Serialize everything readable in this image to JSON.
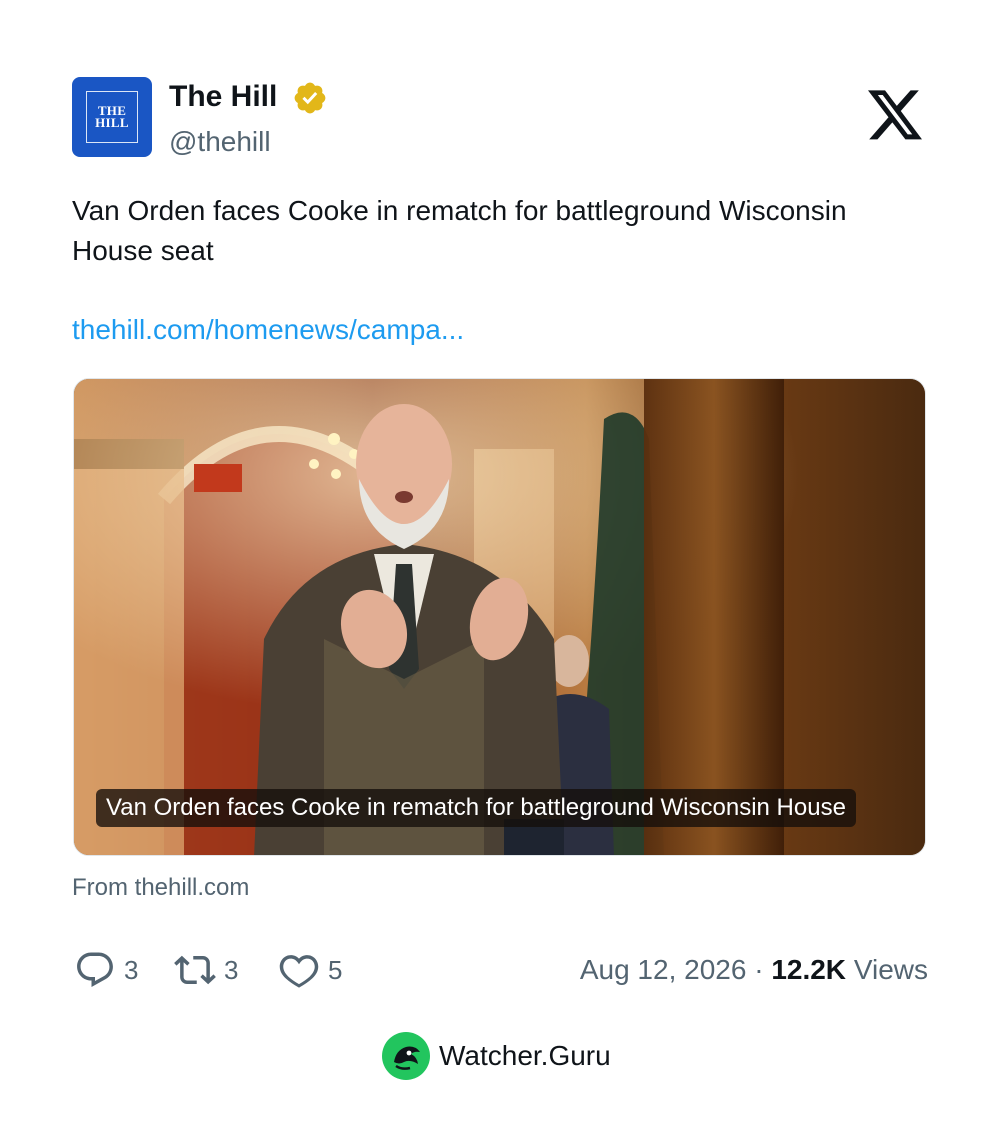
{
  "author": {
    "display_name": "The Hill",
    "handle": "@thehill",
    "avatar_text_line1": "THE",
    "avatar_text_line2": "HILL",
    "avatar_color": "#1a56c4",
    "verified_badge_color": "#e2b719"
  },
  "tweet": {
    "text": "Van Orden faces Cooke in rematch for battleground Wisconsin House seat",
    "link": "thehill.com/homenews/campa..."
  },
  "media": {
    "caption": "Van Orden faces Cooke in rematch for battleground Wisconsin House",
    "source": "From thehill.com"
  },
  "stats": {
    "replies": "3",
    "reposts": "3",
    "likes": "5",
    "date": "Aug 12, 2026",
    "separator": "·",
    "views_count": "12.2K",
    "views_label": "Views"
  },
  "footer": {
    "brand_name": "Watcher.Guru",
    "brand_color": "#22c55e"
  },
  "colors": {
    "link": "#1d9bf0",
    "secondary_text": "#536471",
    "primary_text": "#0f1419"
  }
}
